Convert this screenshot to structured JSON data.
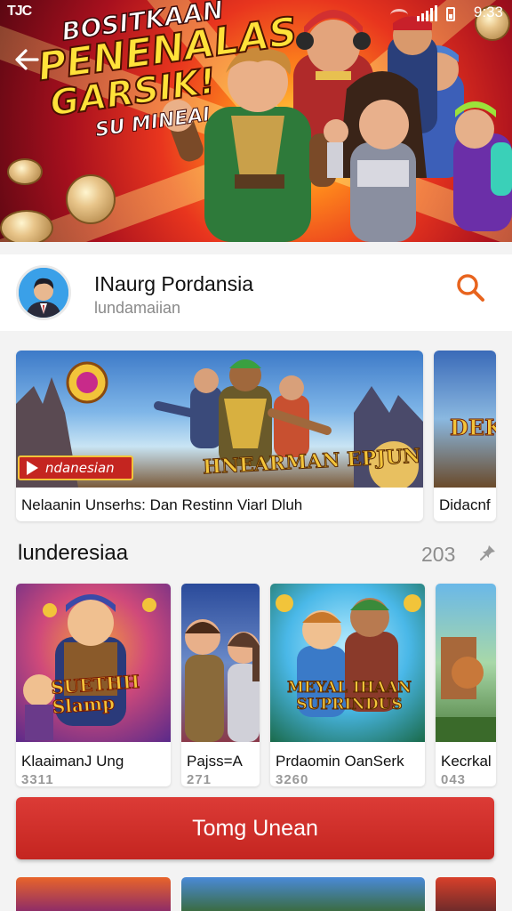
{
  "status_bar": {
    "left_label": "TJC",
    "time": "9:33"
  },
  "hero": {
    "line1": "BOSITKAAN",
    "line2": "PENENALAS",
    "line3": "GARSIK!",
    "line4": "SU MINEAI"
  },
  "channel": {
    "name": "INaurg Pordansia",
    "subtitle": "lundamaiian"
  },
  "featured": [
    {
      "title": "Nelaanin Unserhs: Dan Restinn Viarl Dluh",
      "badge": "ndanesian",
      "art_title": "HNEARMAN EPJUN"
    },
    {
      "title": "Didacnf",
      "art_title": "DEK"
    }
  ],
  "section": {
    "title": "lunderesiaa",
    "count": "203"
  },
  "games": [
    {
      "title": "KlaaimanJ Ung",
      "meta": "3311",
      "art_title": "SUETHH Slamp"
    },
    {
      "title": "Pajss=A",
      "meta": "271",
      "art_title": ""
    },
    {
      "title": "Prdaomin OanSerk",
      "meta": "3260",
      "art_title": "MEYAL IHAAN SUPRINDUS"
    },
    {
      "title": "Kecrkal",
      "meta": "043",
      "art_title": ""
    }
  ],
  "cta": {
    "label": "Tomg Unean"
  },
  "colors": {
    "accent": "#c42520",
    "hero_bg": "#e8351e",
    "muted_text": "#8a8a8a"
  },
  "icons": [
    "back-arrow-icon",
    "search-icon",
    "pin-icon",
    "wifi-icon",
    "signal-icon",
    "battery-icon"
  ]
}
